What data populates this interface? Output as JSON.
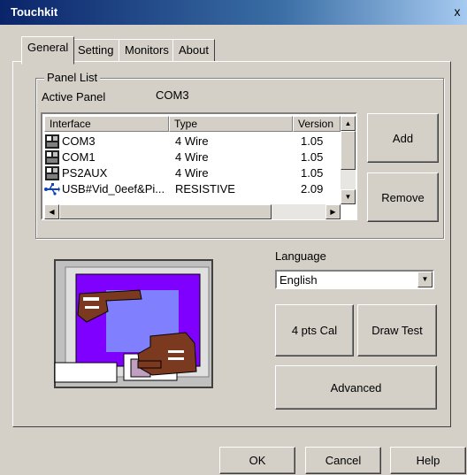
{
  "window": {
    "title": "Touchkit",
    "close_glyph": "x"
  },
  "tabs": [
    {
      "label": "General",
      "active": true
    },
    {
      "label": "Setting",
      "active": false
    },
    {
      "label": "Monitors",
      "active": false
    },
    {
      "label": "About",
      "active": false
    }
  ],
  "panel_list": {
    "legend": "Panel List",
    "active_panel_label": "Active Panel",
    "active_panel_value": "COM3",
    "columns": [
      "Interface",
      "Type",
      "Version"
    ],
    "rows": [
      {
        "icon": "serial-port-icon",
        "interface": "COM3",
        "type": "4 Wire",
        "version": "1.05"
      },
      {
        "icon": "serial-port-icon",
        "interface": "COM1",
        "type": "4 Wire",
        "version": "1.05"
      },
      {
        "icon": "serial-port-icon",
        "interface": "PS2AUX",
        "type": "4 Wire",
        "version": "1.05"
      },
      {
        "icon": "usb-icon",
        "interface": "USB#Vid_0eef&Pi...",
        "type": "RESISTIVE",
        "version": "2.09"
      }
    ],
    "add_label": "Add",
    "remove_label": "Remove"
  },
  "language": {
    "label": "Language",
    "selected": "English"
  },
  "buttons": {
    "cal": "4 pts Cal",
    "draw_test": "Draw Test",
    "advanced": "Advanced",
    "ok": "OK",
    "cancel": "Cancel",
    "help": "Help"
  },
  "colors": {
    "titlebar": "#0a246a",
    "dialog_bg": "#d4d0c8",
    "touch_purple": "#8000ff",
    "hand_brown": "#7b3a1f"
  }
}
